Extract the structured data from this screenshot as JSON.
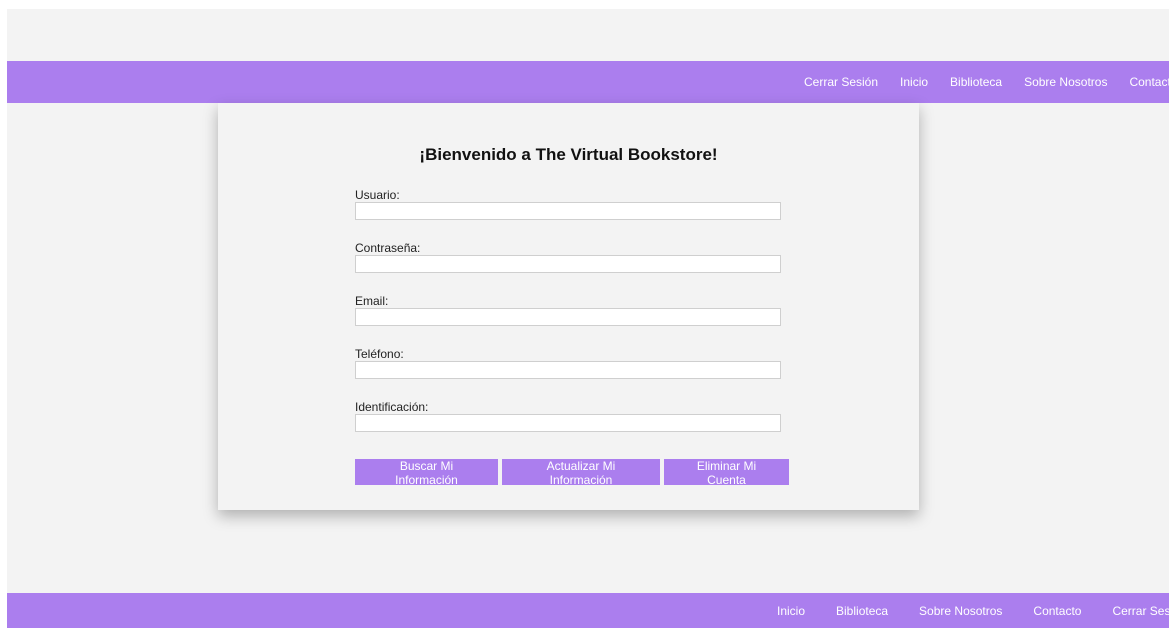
{
  "header": {
    "nav": [
      "Cerrar Sesión",
      "Inicio",
      "Biblioteca",
      "Sobre Nosotros",
      "Contacto"
    ]
  },
  "form": {
    "title": "¡Bienvenido a The Virtual Bookstore!",
    "fields": [
      {
        "label": "Usuario:",
        "value": ""
      },
      {
        "label": "Contraseña:",
        "value": ""
      },
      {
        "label": "Email:",
        "value": ""
      },
      {
        "label": "Teléfono:",
        "value": ""
      },
      {
        "label": "Identificación:",
        "value": ""
      }
    ],
    "buttons": {
      "search": "Buscar Mi Información",
      "update": "Actualizar Mi Información",
      "delete": "Eliminar Mi Cuenta"
    }
  },
  "footer": {
    "nav": [
      "Inicio",
      "Biblioteca",
      "Sobre Nosotros",
      "Contacto",
      "Cerrar Sesión"
    ]
  },
  "colors": {
    "accent": "#ab7eee",
    "background": "#f3f3f3"
  }
}
